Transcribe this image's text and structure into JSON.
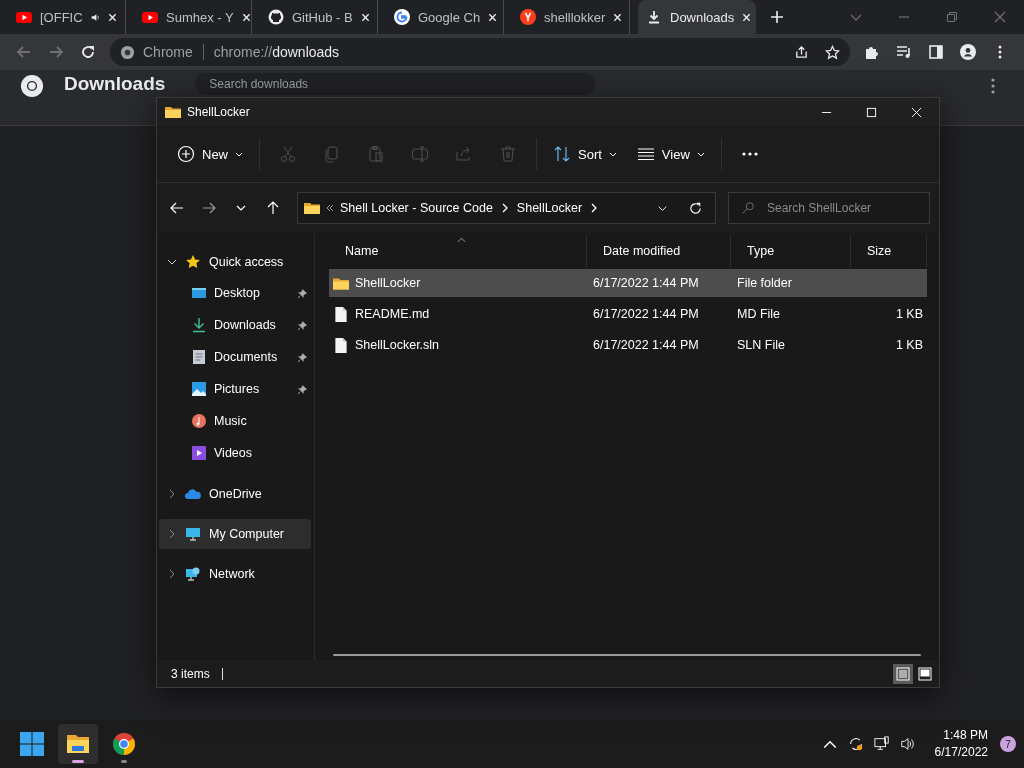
{
  "browser": {
    "tabs": [
      {
        "kind": "youtube",
        "title": "[OFFIC",
        "audio": true,
        "selected": false
      },
      {
        "kind": "youtube",
        "title": "Sumhex - Y",
        "audio": false,
        "selected": false
      },
      {
        "kind": "github",
        "title": "GitHub - B",
        "audio": false,
        "selected": false
      },
      {
        "kind": "google",
        "title": "Google Ch",
        "audio": false,
        "selected": false
      },
      {
        "kind": "yandex",
        "title": "shelllokker",
        "audio": false,
        "selected": false
      },
      {
        "kind": "download",
        "title": "Downloads",
        "audio": false,
        "selected": true
      }
    ],
    "omnibox": {
      "site_label": "Chrome",
      "url_scheme": "chrome://",
      "url_host": "downloads"
    },
    "page": {
      "title": "Downloads",
      "search_placeholder": "Search downloads"
    }
  },
  "explorer": {
    "title": "ShellLocker",
    "toolbar": [
      {
        "kind": "new",
        "label": "New",
        "disabled": false
      },
      {
        "kind": "cut",
        "disabled": true
      },
      {
        "kind": "copy",
        "disabled": true
      },
      {
        "kind": "paste",
        "disabled": true
      },
      {
        "kind": "rename",
        "disabled": true
      },
      {
        "kind": "share",
        "disabled": true
      },
      {
        "kind": "delete",
        "disabled": true
      },
      {
        "kind": "sort",
        "label": "Sort",
        "disabled": false
      },
      {
        "kind": "view",
        "label": "View",
        "disabled": false
      },
      {
        "kind": "more",
        "disabled": false
      }
    ],
    "breadcrumb": [
      "Shell Locker - Source Code",
      "ShellLocker"
    ],
    "search_placeholder": "Search ShellLocker",
    "navigation": [
      {
        "kind": "quick",
        "label": "Quick access",
        "expanded": true,
        "selected": false,
        "children": [
          {
            "kind": "desktop",
            "label": "Desktop",
            "pinned": true,
            "selected": false
          },
          {
            "kind": "downloads",
            "label": "Downloads",
            "pinned": true,
            "selected": false
          },
          {
            "kind": "documents",
            "label": "Documents",
            "pinned": true,
            "selected": false
          },
          {
            "kind": "pictures",
            "label": "Pictures",
            "pinned": true,
            "selected": false
          },
          {
            "kind": "music",
            "label": "Music",
            "pinned": false,
            "selected": false
          },
          {
            "kind": "videos",
            "label": "Videos",
            "pinned": false,
            "selected": false
          }
        ]
      },
      {
        "kind": "onedrive",
        "label": "OneDrive",
        "expanded": false,
        "selected": false
      },
      {
        "kind": "computer",
        "label": "My Computer",
        "expanded": false,
        "selected": true
      },
      {
        "kind": "network",
        "label": "Network",
        "expanded": false,
        "selected": false
      }
    ],
    "columns": [
      "Name",
      "Date modified",
      "Type",
      "Size"
    ],
    "files": [
      {
        "kind": "folder",
        "name": "ShellLocker",
        "date": "6/17/2022 1:44 PM",
        "type": "File folder",
        "selected": true
      },
      {
        "kind": "file",
        "name": "README.md",
        "date": "6/17/2022 1:44 PM",
        "type": "MD File",
        "size": "1 KB",
        "selected": false
      },
      {
        "kind": "file",
        "name": "ShellLocker.sln",
        "date": "6/17/2022 1:44 PM",
        "type": "SLN File",
        "size": "1 KB",
        "selected": false
      }
    ],
    "status": "3 items",
    "view_modes": [
      {
        "kind": "details",
        "selected": true
      },
      {
        "kind": "tiles",
        "selected": false
      }
    ]
  },
  "taskbar": {
    "apps": [
      {
        "kind": "start",
        "active": false
      },
      {
        "kind": "explorer",
        "active": true
      },
      {
        "kind": "chrome",
        "active": false
      }
    ],
    "time": "1:48 PM",
    "date": "6/17/2022",
    "notification_count": "7"
  }
}
